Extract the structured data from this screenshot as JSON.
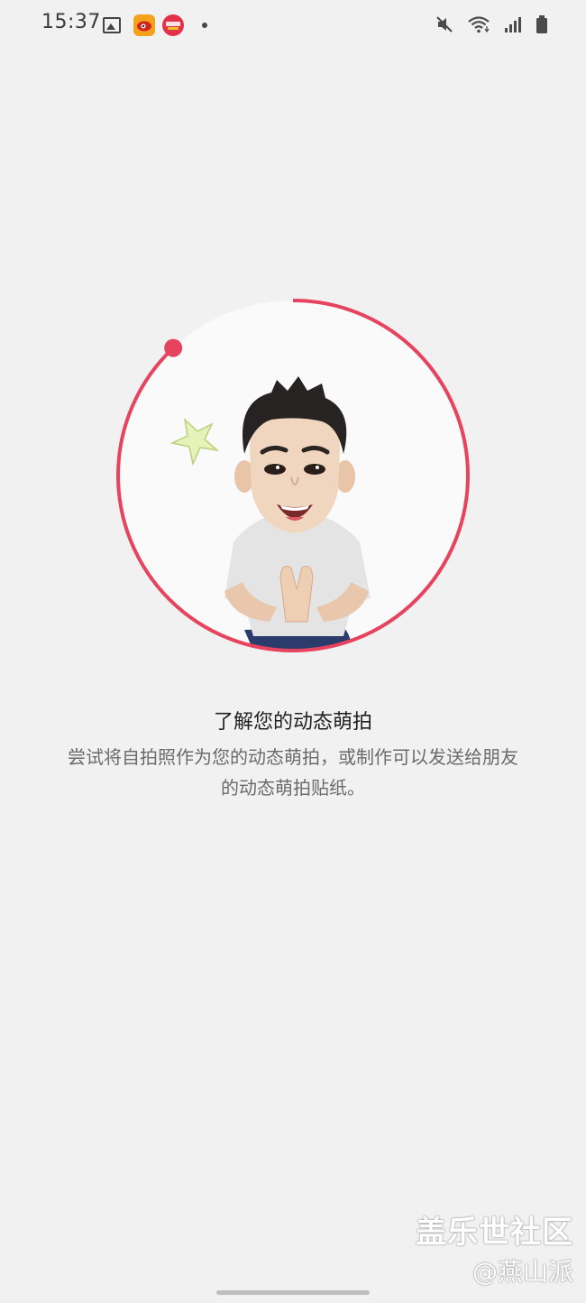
{
  "status_bar": {
    "time": "15:37",
    "left_icons": [
      "gallery-icon",
      "weibo-icon",
      "app-badge-icon",
      "notification-dot"
    ],
    "right_icons": [
      "mute-icon",
      "wifi-icon",
      "signal-icon",
      "battery-icon"
    ]
  },
  "onboarding": {
    "progress_fraction": 0.12,
    "accent_color": "#e6445e",
    "title": "了解您的动态萌拍",
    "description_line1": "尝试将自拍照作为您的动态萌拍，或制作可以发送给朋友",
    "description_line2": "的动态萌拍贴纸。"
  },
  "watermark": {
    "line1": "盖乐世社区",
    "line2": "@燕山派"
  }
}
